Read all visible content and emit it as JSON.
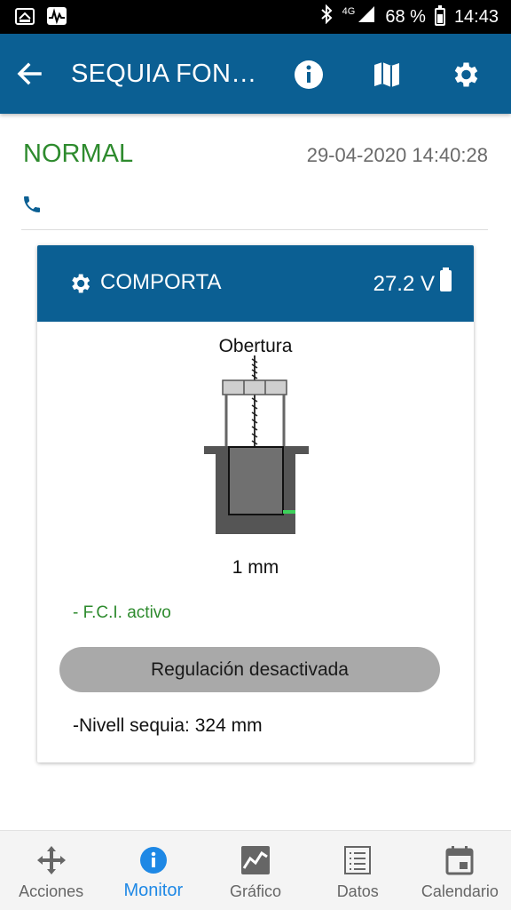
{
  "status_bar": {
    "network": "4G",
    "battery_percent": "68 %",
    "time": "14:43",
    "left_icons": [
      "notification-icon",
      "activity-icon"
    ],
    "right_icons": [
      "bluetooth-icon",
      "signal-icon",
      "battery-icon"
    ]
  },
  "app_bar": {
    "title": "SEQUIA FON…",
    "icons": [
      "back-arrow-icon",
      "info-icon",
      "map-icon",
      "settings-gear-icon"
    ],
    "color": "#0b5f93"
  },
  "header": {
    "status": "NORMAL",
    "status_color": "#2e8b2e",
    "datetime": "29-04-2020 14:40:28",
    "phone_icon": "phone-icon"
  },
  "card": {
    "title": "COMPORTA",
    "title_icon": "gear-icon",
    "voltage": "27.2 V",
    "voltage_icon": "battery-icon",
    "gate_label": "Obertura",
    "gate_value": "1 mm",
    "fci_text": "- F.C.I. activo",
    "regulation_button": "Regulación desactivada",
    "nivell_text": "-Nivell sequia: 324 mm"
  },
  "bottom_nav": {
    "active_color": "#1e88e5",
    "items": [
      {
        "label": "Acciones",
        "icon": "move-arrows-icon",
        "active": false
      },
      {
        "label": "Monitor",
        "icon": "info-icon",
        "active": true
      },
      {
        "label": "Gráfico",
        "icon": "chart-icon",
        "active": false
      },
      {
        "label": "Datos",
        "icon": "list-icon",
        "active": false
      },
      {
        "label": "Calendario",
        "icon": "calendar-icon",
        "active": false
      }
    ]
  }
}
